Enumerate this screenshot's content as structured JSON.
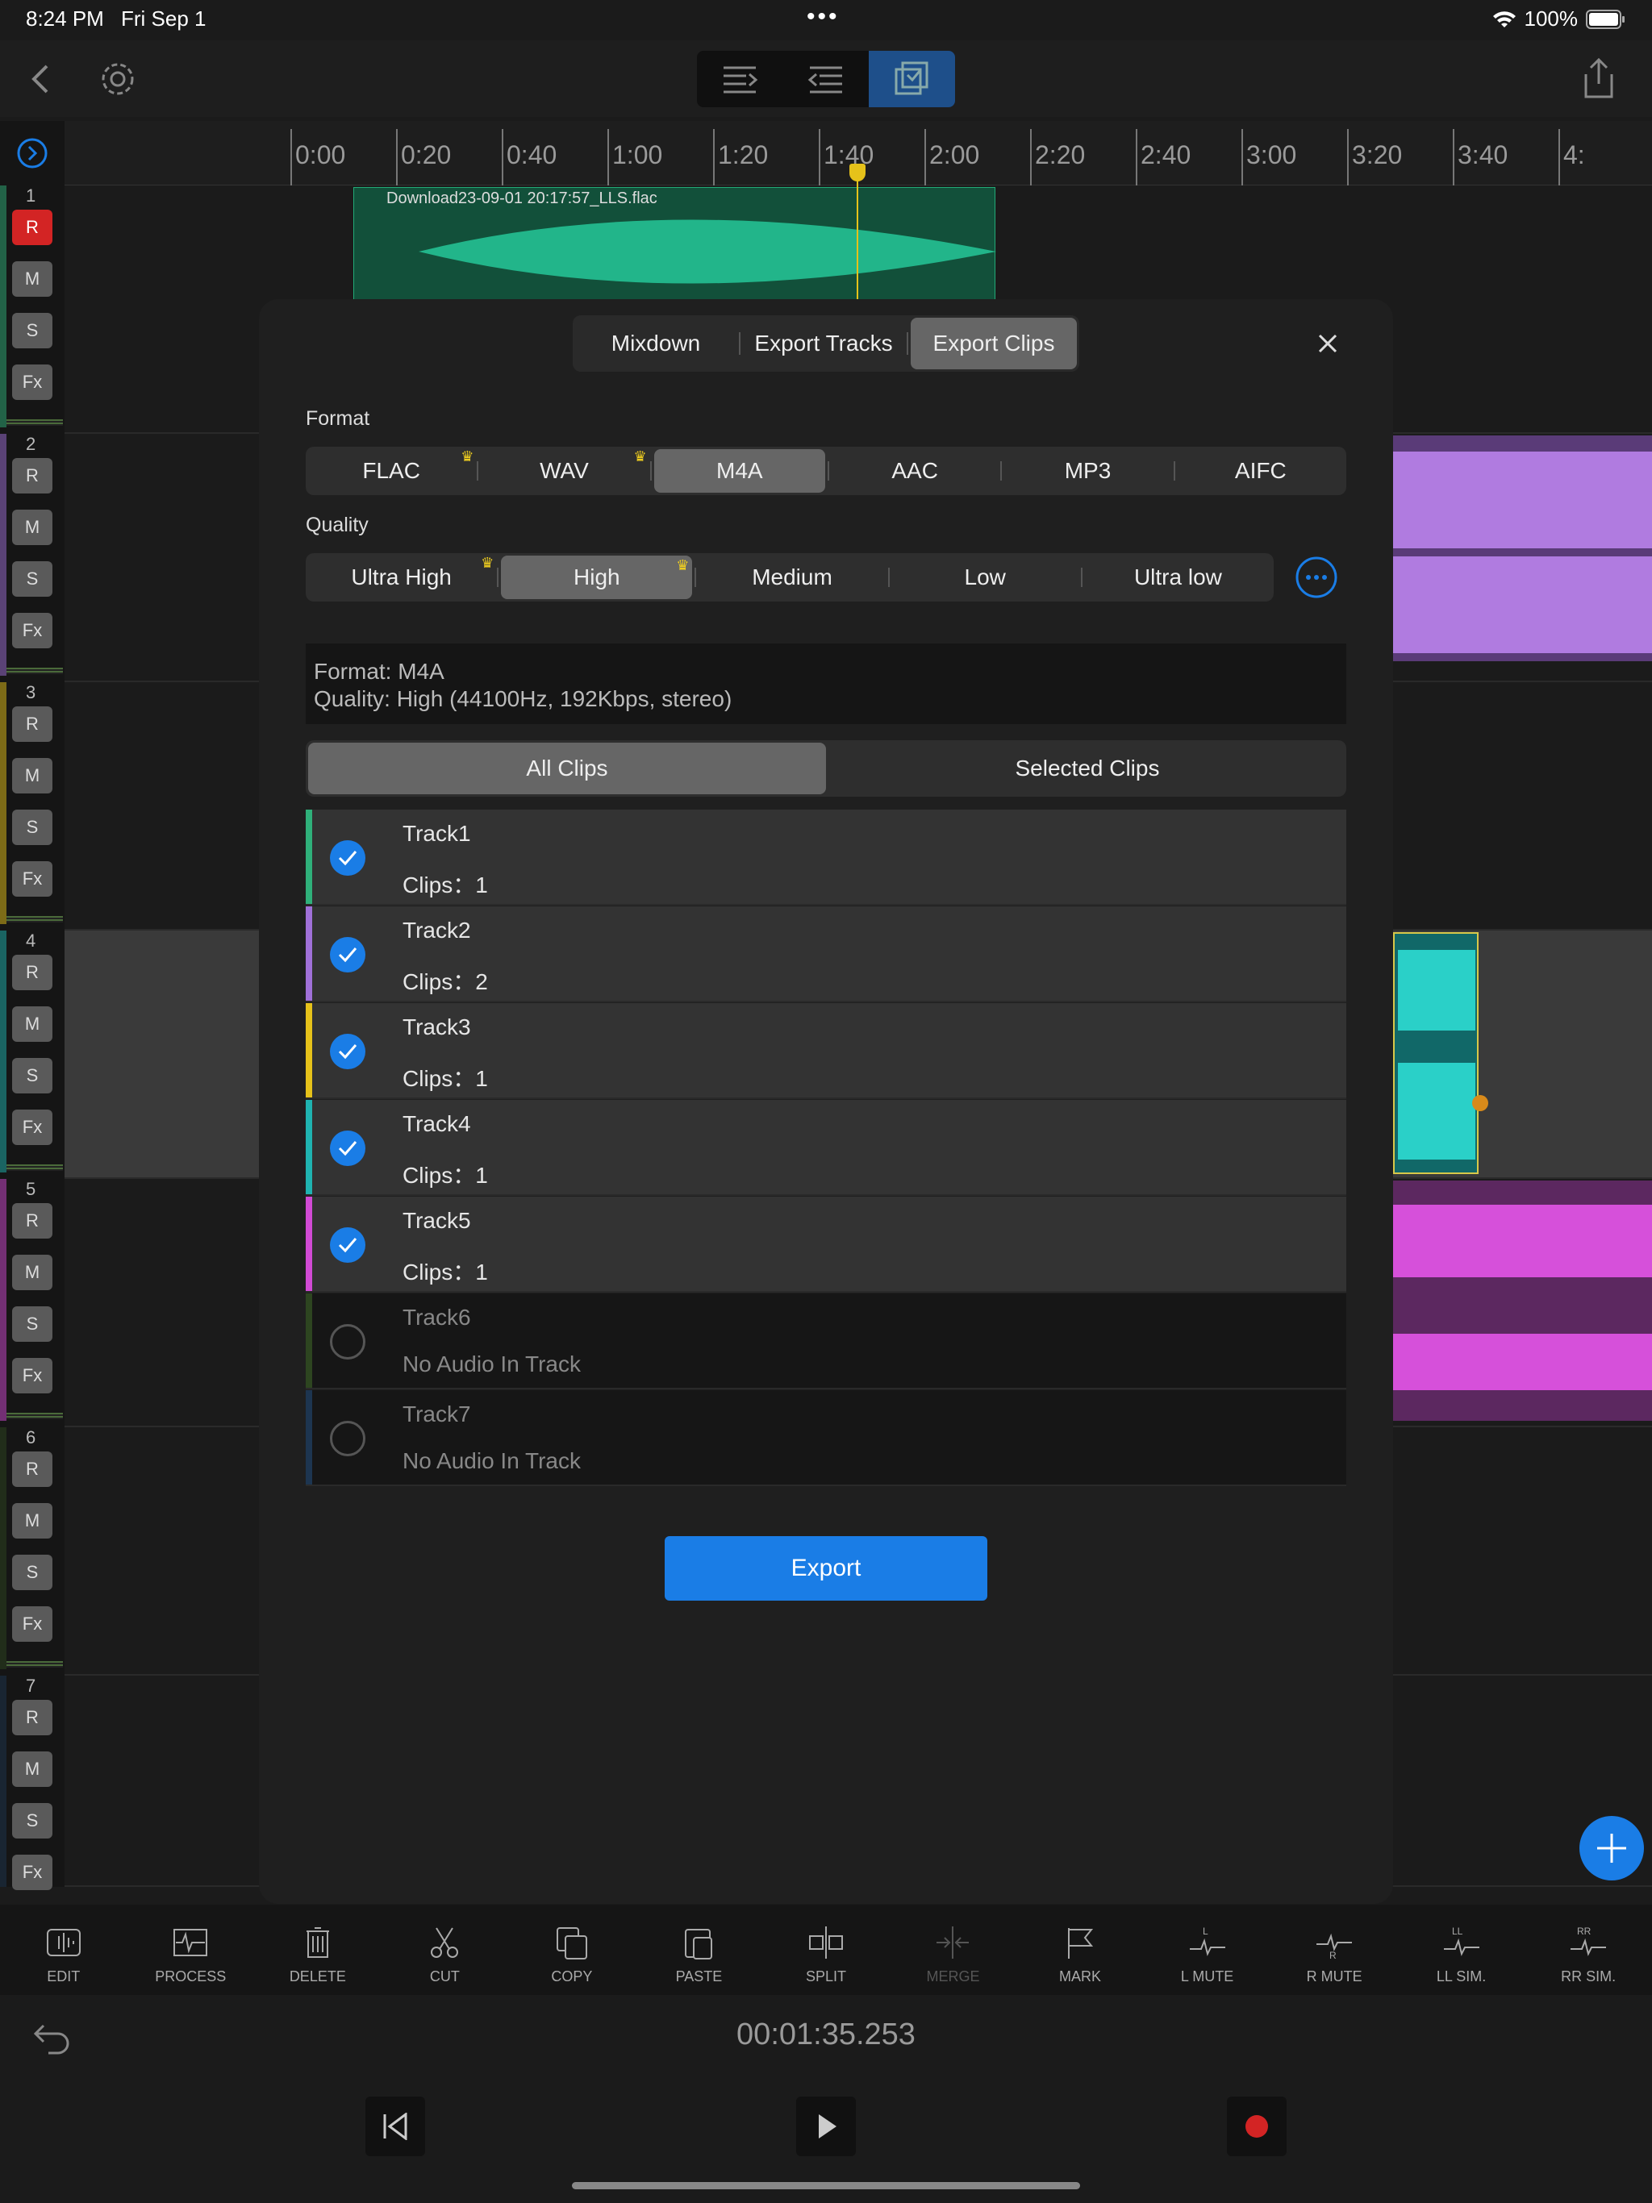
{
  "status": {
    "time": "8:24 PM",
    "date": "Fri Sep 1",
    "battery": "100%"
  },
  "timeline": {
    "ticks": [
      "0:00",
      "0:20",
      "0:40",
      "1:00",
      "1:20",
      "1:40",
      "2:00",
      "2:20",
      "2:40",
      "3:00",
      "3:20",
      "3:40",
      "4:"
    ],
    "clip_name": "Download23-09-01 20:17:57_LLS.flac"
  },
  "track_strip": [
    {
      "num": "1",
      "r": "R",
      "m": "M",
      "s": "S",
      "fx": "Fx"
    },
    {
      "num": "2",
      "r": "R",
      "m": "M",
      "s": "S",
      "fx": "Fx"
    },
    {
      "num": "3",
      "r": "R",
      "m": "M",
      "s": "S",
      "fx": "Fx"
    },
    {
      "num": "4",
      "r": "R",
      "m": "M",
      "s": "S",
      "fx": "Fx"
    },
    {
      "num": "5",
      "r": "R",
      "m": "M",
      "s": "S",
      "fx": "Fx"
    },
    {
      "num": "6",
      "r": "R",
      "m": "M",
      "s": "S",
      "fx": "Fx"
    },
    {
      "num": "7",
      "r": "R",
      "m": "M",
      "s": "S",
      "fx": "Fx"
    }
  ],
  "modal": {
    "tabs": [
      "Mixdown",
      "Export Tracks",
      "Export Clips"
    ],
    "active_tab": "Export Clips",
    "format_label": "Format",
    "formats": [
      "FLAC",
      "WAV",
      "M4A",
      "AAC",
      "MP3",
      "AIFC"
    ],
    "selected_format": "M4A",
    "quality_label": "Quality",
    "qualities": [
      "Ultra High",
      "High",
      "Medium",
      "Low",
      "Ultra low"
    ],
    "selected_quality": "High",
    "info_format": "Format: M4A",
    "info_quality": "Quality: High (44100Hz,  192Kbps, stereo)",
    "scope": [
      "All Clips",
      "Selected Clips"
    ],
    "selected_scope": "All Clips",
    "tracks": [
      {
        "name": "Track1",
        "sub": "Clips：1",
        "checked": true,
        "color": "#2fb07a"
      },
      {
        "name": "Track2",
        "sub": "Clips：2",
        "checked": true,
        "color": "#a070d8"
      },
      {
        "name": "Track3",
        "sub": "Clips：1",
        "checked": true,
        "color": "#e6c21a"
      },
      {
        "name": "Track4",
        "sub": "Clips：1",
        "checked": true,
        "color": "#1fb3b0"
      },
      {
        "name": "Track5",
        "sub": "Clips：1",
        "checked": true,
        "color": "#d14ad4"
      },
      {
        "name": "Track6",
        "sub": "No Audio In Track",
        "checked": false,
        "color": "#2d4520"
      },
      {
        "name": "Track7",
        "sub": "No Audio In Track",
        "checked": false,
        "color": "#1d3550"
      }
    ],
    "export_label": "Export"
  },
  "toolbar": [
    "EDIT",
    "PROCESS",
    "DELETE",
    "CUT",
    "COPY",
    "PASTE",
    "SPLIT",
    "MERGE",
    "MARK",
    "L MUTE",
    "R MUTE",
    "LL SIM.",
    "RR SIM."
  ],
  "transport": {
    "timecode": "00:01:35.253"
  },
  "colors": {
    "accent": "#1a7de6",
    "record": "#d32424"
  }
}
